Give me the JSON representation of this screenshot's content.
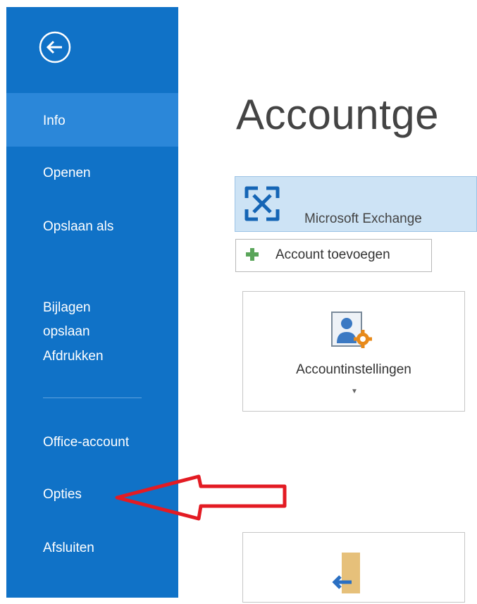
{
  "sidebar": {
    "back_icon": "back-arrow-circle-icon",
    "items": [
      {
        "label": "Info",
        "active": true
      },
      {
        "label": "Openen"
      },
      {
        "label": "Opslaan als"
      },
      {
        "label": "Bijlagen\nopslaan"
      },
      {
        "label": "Afdrukken"
      },
      {
        "label": "Office-account"
      },
      {
        "label": "Opties"
      },
      {
        "label": "Afsluiten"
      }
    ],
    "bg_color": "#1072c7",
    "active_color": "#2b87d9"
  },
  "main": {
    "title": "Accountge",
    "account": {
      "name": "Microsoft Exchange",
      "icon": "exchange-icon"
    },
    "add_account_label": "Account toevoegen",
    "tiles": [
      {
        "label": "Accountinstellingen",
        "icon": "account-settings-icon"
      },
      {
        "label": "",
        "icon": "logout-door-icon"
      }
    ]
  },
  "annotation": {
    "color": "#e31b23",
    "icon": "red-arrow-annotation"
  }
}
